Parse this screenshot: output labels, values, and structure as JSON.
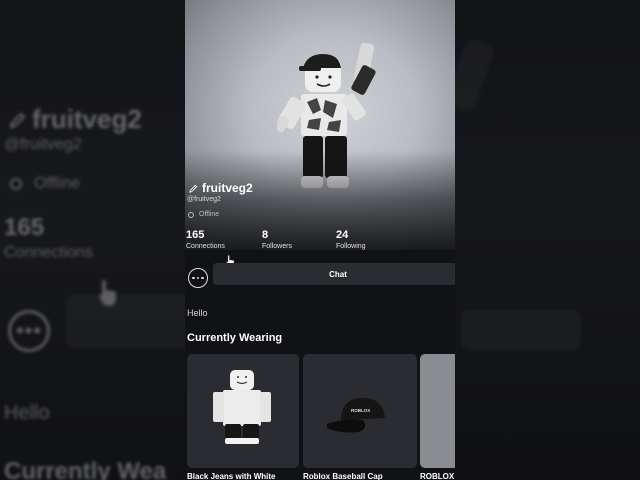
{
  "profile": {
    "username": "fruitveg2",
    "handle": "@fruitveg2",
    "status": "Offline",
    "bio": "Hello"
  },
  "stats": [
    {
      "value": "165",
      "label": "Connections"
    },
    {
      "value": "8",
      "label": "Followers"
    },
    {
      "value": "24",
      "label": "Following"
    }
  ],
  "actions": {
    "chat_label": "Chat",
    "more_icon": "more-icon"
  },
  "wearing": {
    "title": "Currently Wearing",
    "items": [
      {
        "label": "Black Jeans with White"
      },
      {
        "label": "Roblox Baseball Cap"
      },
      {
        "label": "ROBLOX"
      }
    ]
  },
  "cap_logo_text": "ROBLOX",
  "background_zoom": {
    "username": "fruitveg2",
    "handle": "@fruitveg2",
    "status": "Offline",
    "count": "165",
    "count_label": "Connections",
    "bio": "Hello",
    "section_title": "Currently Wea"
  },
  "colors": {
    "background": "#111216",
    "button": "#2a2c31",
    "card": "#2a2c31"
  }
}
